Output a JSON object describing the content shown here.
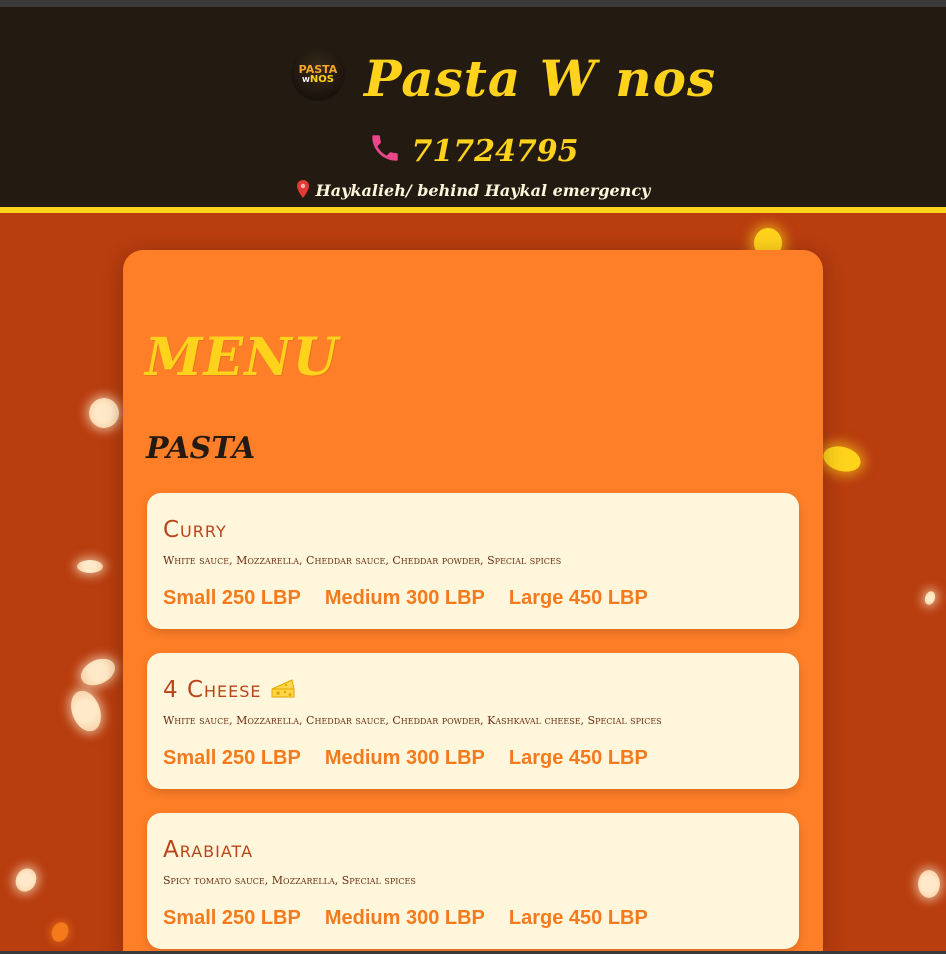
{
  "header": {
    "logo": {
      "line1": "PASTA",
      "line2_small": "W",
      "line2": "NOS"
    },
    "brand_name": "Pasta W nos",
    "phone": "71724795",
    "phone_icon": "phone-icon",
    "address": "Haykalieh/ behind Haykal emergency",
    "address_icon": "pin-icon"
  },
  "menu": {
    "title": "MENU",
    "sections": [
      {
        "title": "PASTA",
        "items": [
          {
            "name": "Curry",
            "emoji": "",
            "description": "White sauce, Mozzarella, Cheddar sauce, Cheddar powder, Special spices",
            "prices": [
              "Small 250 LBP",
              "Medium 300 LBP",
              "Large 450 LBP"
            ]
          },
          {
            "name": "4 Cheese",
            "emoji": "cheese-icon",
            "description": "White sauce, Mozzarella, Cheddar sauce, Cheddar powder, Kashkaval cheese, Special spices",
            "prices": [
              "Small 250 LBP",
              "Medium 300 LBP",
              "Large 450 LBP"
            ]
          },
          {
            "name": "Arabiata",
            "emoji": "",
            "description": "Spicy tomato sauce, Mozzarella, Special spices",
            "prices": [
              "Small 250 LBP",
              "Medium 300 LBP",
              "Large 450 LBP"
            ]
          }
        ]
      }
    ]
  },
  "colors": {
    "header_bg": "#231a12",
    "accent_yellow": "#ffd21c",
    "page_bg": "#b83d0f",
    "panel_orange": "#ff7f28",
    "card_cream": "#fff6dc",
    "price_orange": "#f47a1c",
    "name_brown": "#b8451a"
  }
}
